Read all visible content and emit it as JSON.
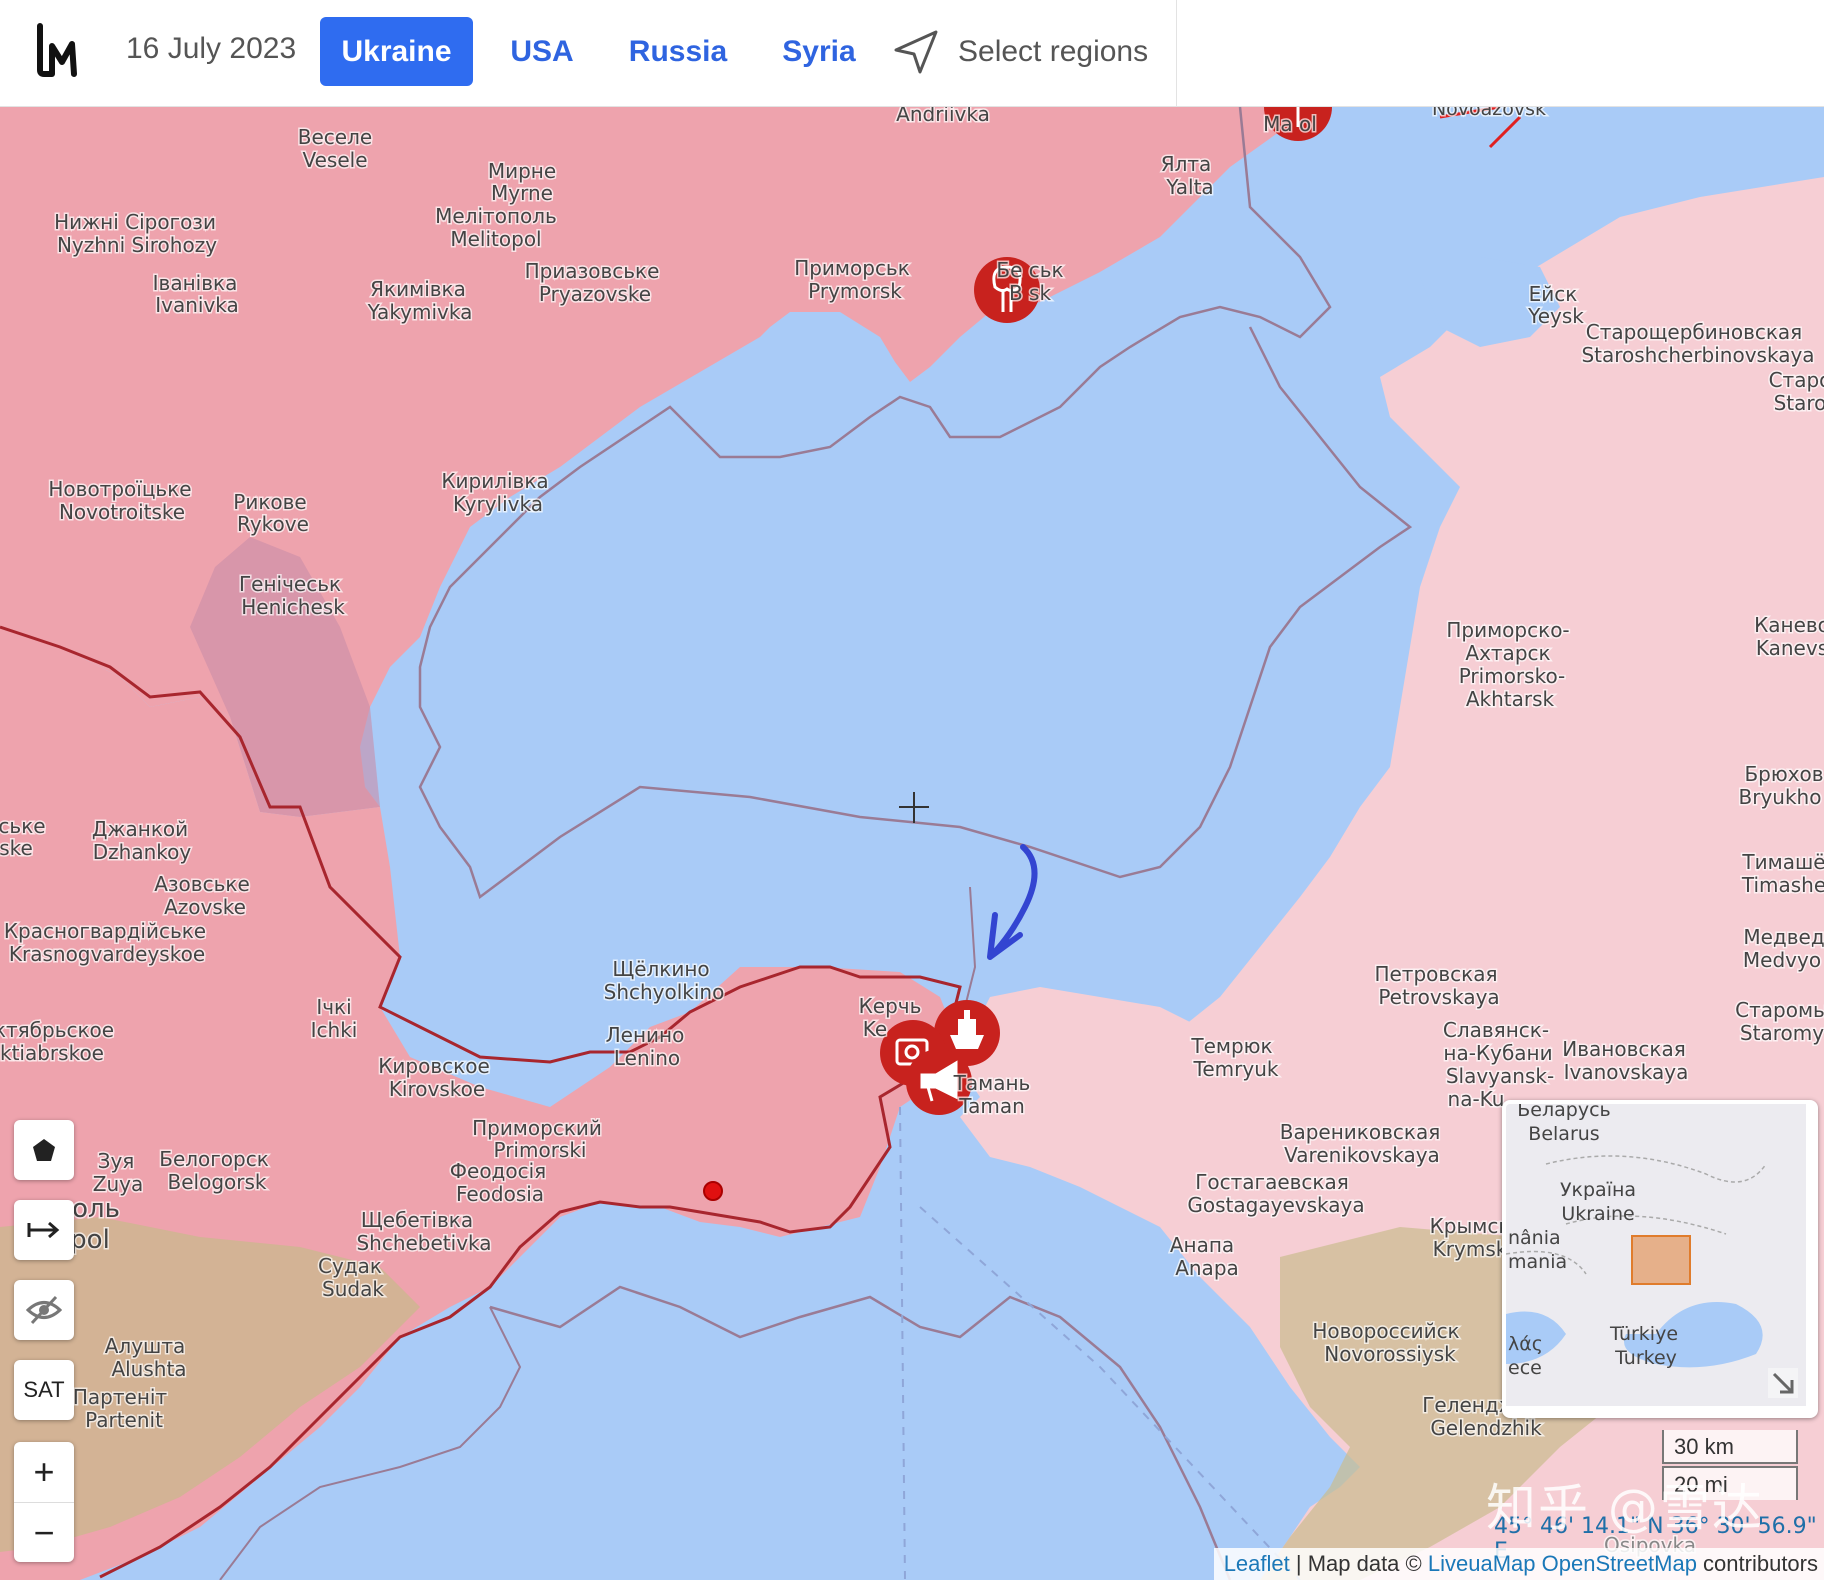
{
  "header": {
    "date": "16 July 2023",
    "tabs": [
      {
        "label": "Ukraine",
        "active": true
      },
      {
        "label": "USA",
        "active": false
      },
      {
        "label": "Russia",
        "active": false
      },
      {
        "label": "Syria",
        "active": false
      }
    ],
    "select_regions": "Select regions"
  },
  "map": {
    "labels": {
      "andriivka": "Andriivka",
      "mariupol": "Ma        ol",
      "nevoazovsk": "Novoazovsk",
      "vesele_cy": "Веселе",
      "vesele": "Vesele",
      "myrne_cy": "Мирне",
      "myrne": "Myrne",
      "melitopol_cy": "Мелітополь",
      "melitopol": "Melitopol",
      "nyzhni_cy": "Нижні Сірогози",
      "nyzhni": "Nyzhni Sirohozy",
      "ivanivka_cy": "Іванівка",
      "ivanivka": "Ivanivka",
      "yakymivka_cy": "Якимівка",
      "yakymivka": "Yakymivka",
      "pryazovske_cy": "Приазовське",
      "pryazovske": "Pryazovske",
      "prymorsk_cy": "Приморськ",
      "prymorsk": "Prymorsk",
      "berdyansk_cy": "Бе        ськ",
      "berdyansk": "B        sk",
      "yalta_cy": "Ялта",
      "yalta": "Yalta",
      "yeysk_cy": "Ейск",
      "yeysk": "Yeysk",
      "staroshch_cy": "Старощербиновская",
      "staroshch": "Staroshcherbinovskaya",
      "staro_cy": "Старо",
      "staro": "Staro",
      "novotr_cy": "Новотроїцьке",
      "novotr": "Novotroitske",
      "rykove_cy": "Рикове",
      "rykove": "Rykove",
      "kyrylivka_cy": "Кирилівка",
      "kyrylivka": "Kyrylivka",
      "henichesk_cy": "Генічеськ",
      "henichesk": "Henichesk",
      "primakh_cy1": "Приморско-",
      "primakh_cy2": "Ахтарск",
      "primakh_1": "Primorsko-",
      "primakh_2": "Akhtarsk",
      "kanev_cy": "Канево",
      "kanev": "Kanevs",
      "bryukh_cy": "Брюхов",
      "bryukh": "Bryukho",
      "timash_cy": "Тимашё",
      "timash": "Timashe",
      "medved_cy": "Медвед",
      "medved": "Medvyo",
      "starom_cy": "Старомы",
      "starom": "Staromy",
      "ske_cy": "ське",
      "ske": "ske",
      "dzhankoy_cy": "Джанкой",
      "dzhankoy": "Dzhankoy",
      "azovske_cy": "Азовське",
      "azovske": "Azovske",
      "krasnogv_cy": "Красногвардійське",
      "krasnogv": "Krasnogvardeyskoe",
      "oktyabr_cy": "ктябрьское",
      "oktyabr": "ktiabrskoe",
      "ichki_cy": "Ічкі",
      "ichki": "Ichki",
      "kirovske_cy": "Кировское",
      "kirovske": "Kirovskoe",
      "shchelk_cy": "Щёлкино",
      "shchelk": "Shchyolkino",
      "lenino_cy": "Ленино",
      "lenino": "Lenino",
      "kerch_cy": "Керчь",
      "kerch": "Ke",
      "prymorskyi_cy": "Приморский",
      "prymorskyi": "Primorski",
      "feodosia_cy": "Феодосія",
      "feodosia": "Feodosia",
      "zuya_cy": "Зуя",
      "zuya": "Zuya",
      "belogorsk_cy": "Белогорск",
      "belogorsk": "Belogorsk",
      "simf_cy": "оль",
      "simf": "pol",
      "shchebet_cy": "Щебетівка",
      "shchebet": "Shchebetivka",
      "sudak_cy": "Судак",
      "sudak": "Sudak",
      "alushta_cy": "Алушта",
      "alushta": "Alushta",
      "partenit_cy": "Партеніт",
      "partenit": "Partenit",
      "taman_cy": "Тамань",
      "taman": "Taman",
      "temryuk_cy": "Темрюк",
      "temryuk": "Temryuk",
      "petrov_cy": "Петровская",
      "petrov": "Petrovskaya",
      "slavyansk_cy1": "Славянск-",
      "slavyansk_cy2": "на-Кубани",
      "slavyansk_1": "Slavyansk-",
      "slavyansk_2": "na-Ku",
      "ivanov_cy": "Ивановская",
      "ivanov": "Ivanovskaya",
      "varen_cy": "Варениковская",
      "varen": "Varenikovskaya",
      "gostag_cy": "Гостагаевская",
      "gostag": "Gostagayevskaya",
      "krymsk_cy": "Крымск",
      "krymsk": "Krymsk",
      "anapa_cy": "Анапа",
      "anapa": "Anapa",
      "novoross_cy": "Новороссийск",
      "novoross": "Novorossiysk",
      "gelendzhik_cy": "Геленджик",
      "gelendzhik": "Gelendzhik",
      "osipovka": "Osipovka"
    },
    "colors": {
      "sea": "#a9cbf7",
      "occupied": "#eea3ad",
      "russia": "#f6ced4",
      "frontline": "#a8262e",
      "marker": "#c8221e",
      "arrow": "#3345d1"
    },
    "icons": [
      "nuclear-icon",
      "nuclear-icon",
      "photo-icon",
      "ship-icon",
      "megaphone-icon",
      "blue-arrow-annotation",
      "crosshair-icon"
    ]
  },
  "controls": {
    "sat_label": "SAT",
    "zoom_in": "+",
    "zoom_out": "−"
  },
  "minimap": {
    "belarus_cy": "Беларусь",
    "belarus": "Belarus",
    "ukraine_cy": "Україна",
    "ukraine": "Ukraine",
    "romania_1": "nânia",
    "romania_2": "mania",
    "turkey_cy": "Türkiye",
    "turkey": "Turkey",
    "greece_1": "λάς",
    "greece_2": "ece"
  },
  "scale": {
    "km": "30 km",
    "mi": "20 mi"
  },
  "coordinates": "45° 46' 14.1\" N 36° 30' 56.9\" E",
  "attribution": {
    "leaflet": "Leaflet",
    "mapdata": " | Map data © ",
    "liveuamap": "LiveuaMap",
    "osm": "OpenStreetMap",
    "contributors": " contributors"
  },
  "watermark": "知乎 @雪达"
}
